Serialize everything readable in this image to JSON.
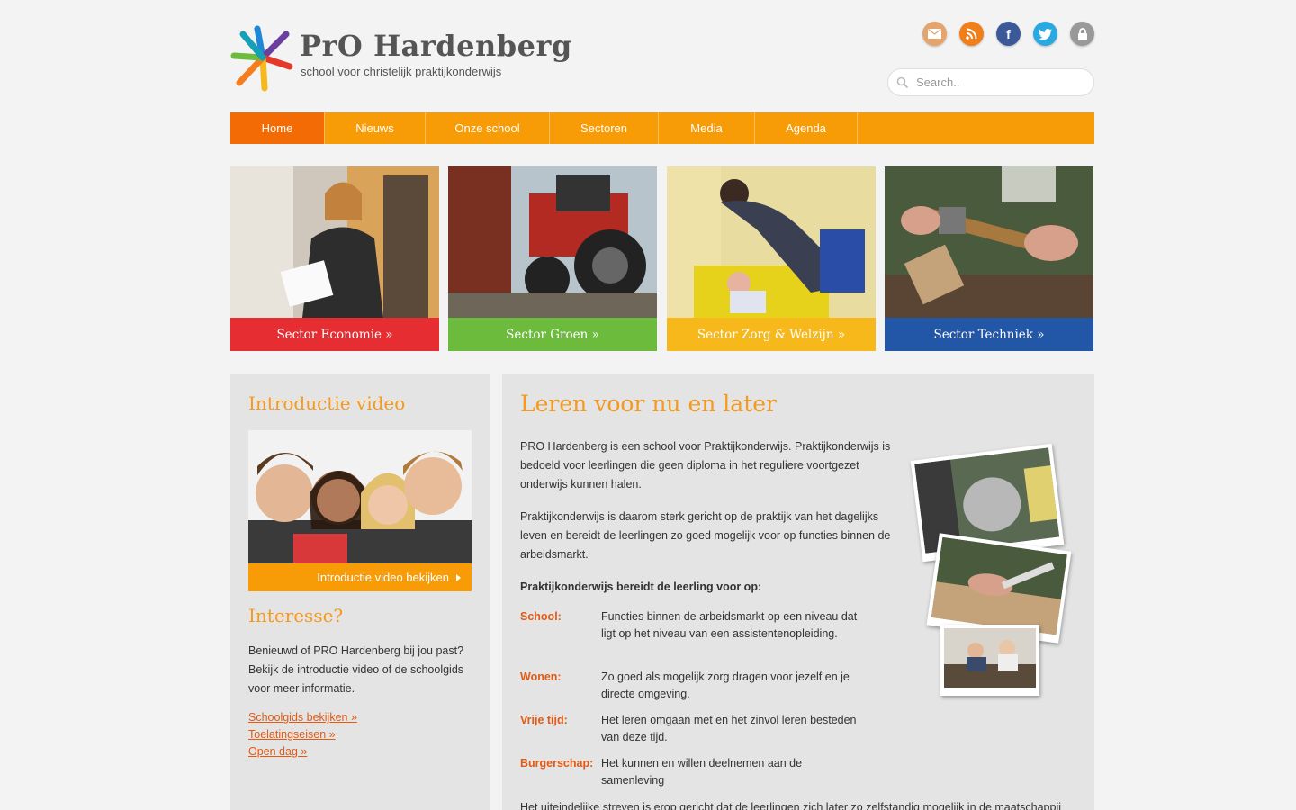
{
  "header": {
    "logo_title": "PrO Hardenberg",
    "logo_subtitle": "school voor christelijk praktijkonderwijs",
    "social_icons": [
      "mail-icon",
      "rss-icon",
      "facebook-icon",
      "twitter-icon",
      "lock-icon"
    ],
    "search": {
      "placeholder": "Search.."
    }
  },
  "nav": {
    "items": [
      {
        "label": "Home",
        "active": true
      },
      {
        "label": "Nieuws"
      },
      {
        "label": "Onze school"
      },
      {
        "label": "Sectoren"
      },
      {
        "label": "Media"
      },
      {
        "label": "Agenda"
      }
    ]
  },
  "sectors": [
    {
      "label": "Sector Economie »",
      "color": "#e62d31"
    },
    {
      "label": "Sector Groen »",
      "color": "#6cbb3c"
    },
    {
      "label": "Sector Zorg & Welzijn »",
      "color": "#f6b81b"
    },
    {
      "label": "Sector Techniek »",
      "color": "#2257a8"
    }
  ],
  "sidebar": {
    "video_title": "Introductie video",
    "video_button": "Introductie video bekijken",
    "interest_title": "Interesse?",
    "interest_text": "Benieuwd of PRO Hardenberg bij jou past? Bekijk de introductie video of de schoolgids voor meer informatie.",
    "links": [
      "Schoolgids bekijken »",
      "Toelatingseisen »",
      "Open dag »"
    ]
  },
  "main": {
    "title": "Leren voor nu en later",
    "paragraph1": "PRO Hardenberg is een school voor Praktijkonderwijs. Praktijkonderwijs is bedoeld voor leerlingen die geen diploma in het reguliere voortgezet onderwijs kunnen halen.",
    "paragraph2": "Praktijkonderwijs is daarom sterk gericht op de praktijk van het dagelijks leven en bereidt de leerlingen zo goed mogelijk voor op functies binnen de arbeidsmarkt.",
    "subheading": "Praktijkonderwijs bereidt de leerling voor op:",
    "definitions": [
      {
        "term": "School:",
        "desc": "Functies binnen de arbeidsmarkt op een niveau dat ligt op het niveau van een assistentenopleiding."
      },
      {
        "term": "Wonen:",
        "desc": "Zo goed als mogelijk zorg dragen voor jezelf en je directe omgeving."
      },
      {
        "term": "Vrije tijd:",
        "desc": "Het leren omgaan met en het zinvol leren besteden van deze tijd."
      },
      {
        "term": "Burgerschap:",
        "desc": "Het kunnen en willen deelnemen aan de samenleving"
      }
    ],
    "cut_line": "Het uiteindelijke streven is erop gericht dat de leerlingen zich later zo zelfstandig mogelijk in de maatschappij"
  },
  "colors": {
    "accent_orange": "#f79b06",
    "active_orange": "#f26b05",
    "heading_orange": "#f39a1f",
    "link_red_orange": "#e25a14",
    "panel_gray": "#e4e4e4",
    "page_bg": "#f3f3f3"
  }
}
